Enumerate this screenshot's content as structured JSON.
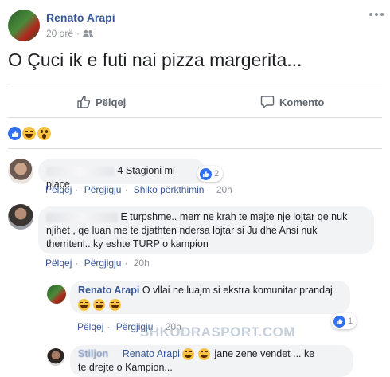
{
  "post": {
    "author": "Renato Arapi",
    "time": "20 orë",
    "text": "O Çuci ik e futi nai pizza margerita...",
    "actions": {
      "like": "Pëlqej",
      "comment": "Komento"
    },
    "menu_icon": "more-icon"
  },
  "comments": [
    {
      "author": "",
      "text": "4 Stagioni mi piace",
      "links": {
        "like": "Pëlqej",
        "reply": "Përgjigju",
        "translate": "Shiko përkthimin",
        "time": "20h"
      },
      "reaction_count": "2"
    },
    {
      "author": "",
      "text_line1": "E turpshme.. merr ne krah te majte nje lojtar qe nuk",
      "text_line2": "njihet , qe luan me te djathten ndersa lojtar si Ju dhe Ansi nuk",
      "text_line3": "therriteni.. ky eshte TURP o kampion",
      "links": {
        "like": "Pëlqej",
        "reply": "Përgjigju",
        "time": "20h"
      }
    },
    {
      "author": "Renato Arapi",
      "text": "O vllai ne luajm si ekstra komunitar prandaj",
      "links": {
        "like": "Pëlqej",
        "reply": "Përgjigju",
        "time": "20h"
      },
      "reaction_count": "1"
    },
    {
      "author": "Stiljon",
      "mention": "Renato Arapi",
      "text_a": "jane zene vendet ... ke",
      "text_line2": "te drejte o Kampion..."
    }
  ],
  "watermark": "SHKODRASPORT.COM",
  "colors": {
    "link": "#385898",
    "like_blue": "#2f6ff0",
    "emoji_yellow": "#f7c23f",
    "bubble": "#f2f3f5"
  }
}
